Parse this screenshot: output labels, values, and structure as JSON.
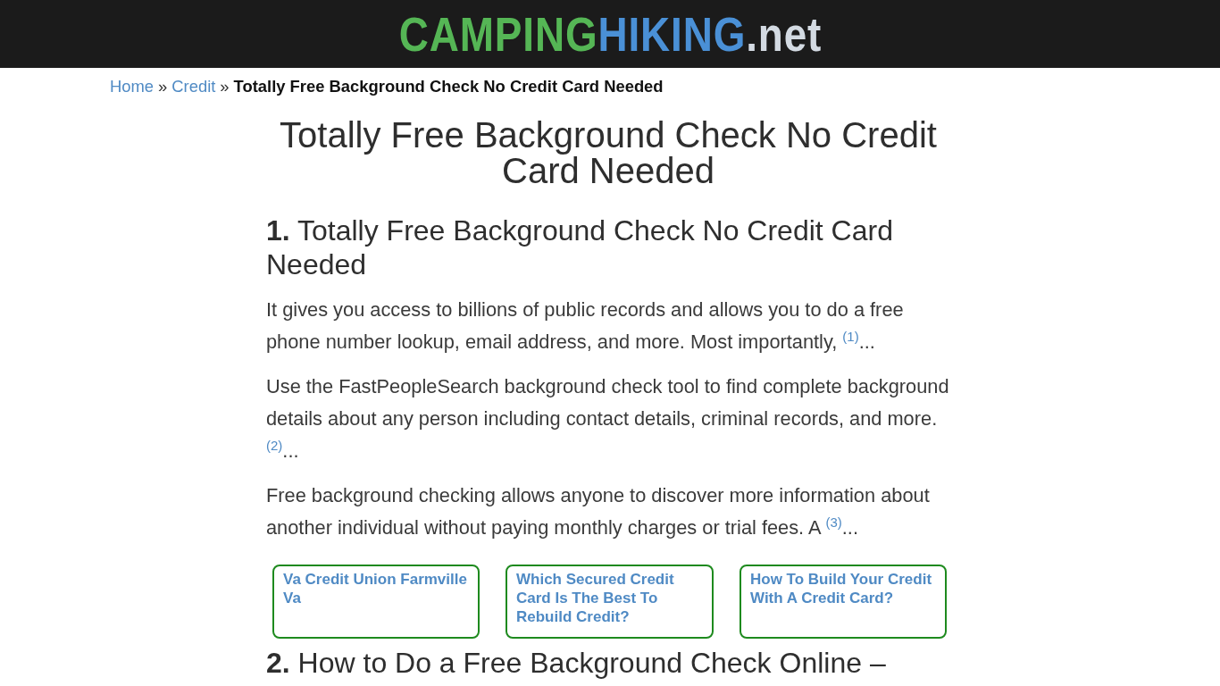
{
  "header": {
    "logo": [
      {
        "text": "CAMPING",
        "color": "#55b655"
      },
      {
        "text": "HIKING",
        "color": "#4a90d6"
      },
      {
        "text": ".net",
        "color": "#d3dae2"
      }
    ]
  },
  "breadcrumb": [
    {
      "kind": "link",
      "text": "Home"
    },
    {
      "kind": "separator",
      "text": "»"
    },
    {
      "kind": "link",
      "text": "Credit"
    },
    {
      "kind": "separator",
      "text": "»"
    },
    {
      "kind": "current",
      "text": "Totally Free Background Check No Credit Card Needed"
    }
  ],
  "page_title": "Totally Free Background Check No Credit Card Needed",
  "sections": [
    {
      "number": "1.",
      "title": "Totally Free Background Check No Credit Card Needed",
      "paragraphs": [
        {
          "text": "It gives you access to billions of public records and allows you to do a free phone number lookup, email address, and more. Most importantly,",
          "ref": "(1)",
          "tail": "..."
        },
        {
          "text": "Use the FastPeopleSearch background check tool to find complete background details about any person including contact details, criminal records, and more.",
          "ref": "(2)",
          "tail": "..."
        },
        {
          "text": "Free background checking allows anyone to discover more information about another individual without paying monthly charges or trial fees. A",
          "ref": "(3)",
          "tail": "..."
        }
      ],
      "related": [
        "Va Credit Union Farmville Va",
        "Which Secured Credit Card Is The Best To Rebuild Credit?",
        "How To Build Your Credit With A Credit Card?"
      ]
    },
    {
      "number": "2.",
      "title": "How to Do a Free Background Check Online –"
    }
  ]
}
